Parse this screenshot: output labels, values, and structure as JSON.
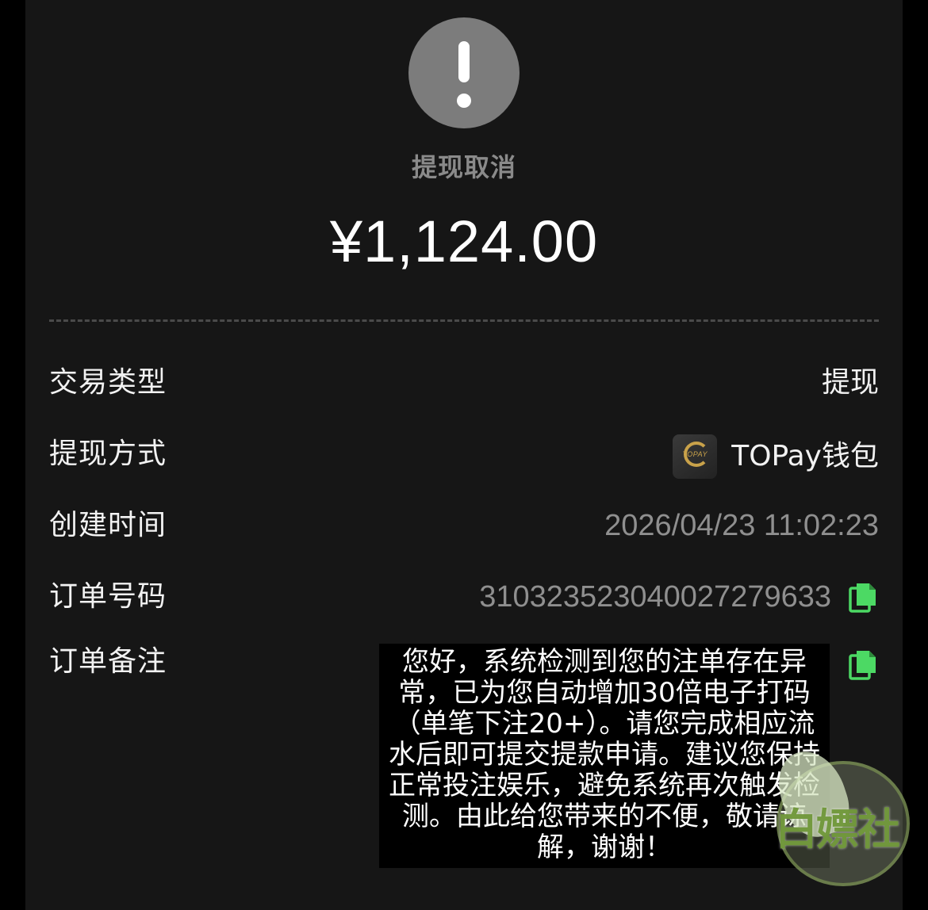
{
  "status": {
    "label": "提现取消",
    "icon": "exclamation-icon"
  },
  "amount": "¥1,124.00",
  "details": {
    "type": {
      "label": "交易类型",
      "value": "提现"
    },
    "method": {
      "label": "提现方式",
      "value": "TOPay钱包",
      "logo_text": "TOPAY"
    },
    "created": {
      "label": "创建时间",
      "value": "2026/04/23 11:02:23"
    },
    "order_no": {
      "label": "订单号码",
      "value": "310323523040027279633"
    },
    "remark": {
      "label": "订单备注",
      "value": "您好，系统检测到您的注单存在异常，已为您自动增加30倍电子打码（单笔下注20+）。请您完成相应流水后即可提交提款申请。建议您保持正常投注娱乐，避免系统再次触发检测。由此给您带来的不便，敬请谅解，谢谢！"
    }
  },
  "watermark": {
    "text": "白嫖社"
  },
  "colors": {
    "background": "#000000",
    "card": "#161616",
    "status_icon": "#7c7c7c",
    "muted_text": "#8f8f8f",
    "copy_icon": "#4cd964",
    "logo_gold": "#c9a24a"
  }
}
